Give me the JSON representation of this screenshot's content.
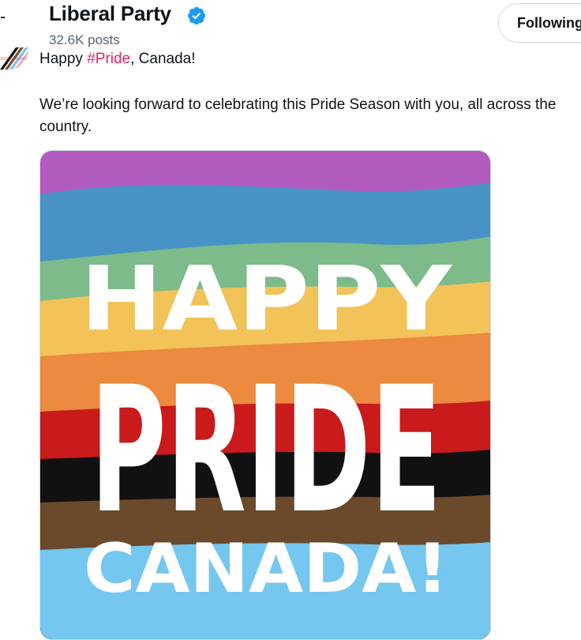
{
  "header": {
    "back_glyph": "-",
    "account_name": "Liberal Party",
    "posts_count": "32.6K posts",
    "follow_label": "Following"
  },
  "tweet": {
    "line1_prefix": "Happy ",
    "hashtag": "#Pride",
    "line1_suffix": ", Canada!",
    "body": "We’re looking forward to celebrating this Pride Season with you, all across the country."
  },
  "media": {
    "line1": "HAPPY",
    "line2": "PRIDE",
    "line3": "CANADA!"
  },
  "colors": {
    "hashtag": "#e0245e",
    "verified": "#1d9bf0",
    "stripes": [
      "#b25bbf",
      "#4793c6",
      "#7dbb8a",
      "#f2c359",
      "#ec8a3f",
      "#c91b1b",
      "#111111",
      "#6a4a2b",
      "#75c7f0"
    ]
  }
}
